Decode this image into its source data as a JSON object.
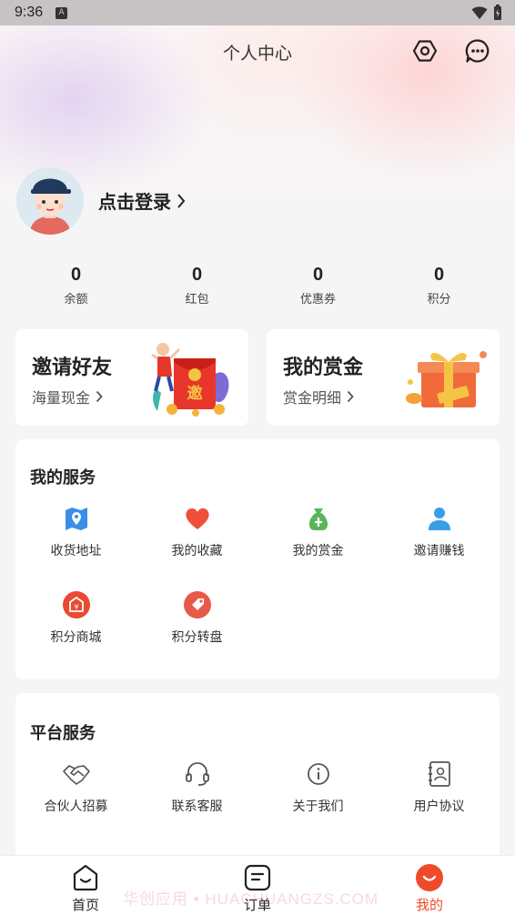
{
  "status_bar": {
    "time": "9:36",
    "notification_icon": "A"
  },
  "header": {
    "title": "个人中心",
    "settings_icon": "settings-hexagon-icon",
    "message_icon": "chat-bubble-icon"
  },
  "profile": {
    "login_label": "点击登录",
    "chevron": "›"
  },
  "stats": [
    {
      "value": "0",
      "label": "余额"
    },
    {
      "value": "0",
      "label": "红包"
    },
    {
      "value": "0",
      "label": "优惠券"
    },
    {
      "value": "0",
      "label": "积分"
    }
  ],
  "promos": {
    "invite": {
      "title": "邀请好友",
      "subtitle": "海量现金",
      "badge_char": "邀"
    },
    "bounty": {
      "title": "我的赏金",
      "subtitle": "赏金明细"
    }
  },
  "my_services": {
    "title": "我的服务",
    "items": [
      {
        "label": "收货地址",
        "icon": "map-pin-icon"
      },
      {
        "label": "我的收藏",
        "icon": "heart-icon"
      },
      {
        "label": "我的赏金",
        "icon": "money-bag-icon"
      },
      {
        "label": "邀请赚钱",
        "icon": "user-icon"
      },
      {
        "label": "积分商城",
        "icon": "shop-icon"
      },
      {
        "label": "积分转盘",
        "icon": "tag-icon"
      }
    ]
  },
  "platform_services": {
    "title": "平台服务",
    "items": [
      {
        "label": "合伙人招募",
        "icon": "handshake-icon"
      },
      {
        "label": "联系客服",
        "icon": "headset-icon"
      },
      {
        "label": "关于我们",
        "icon": "info-icon"
      },
      {
        "label": "用户协议",
        "icon": "contact-book-icon"
      }
    ]
  },
  "bottom_nav": {
    "items": [
      {
        "label": "首页",
        "active": false
      },
      {
        "label": "订单",
        "active": false
      },
      {
        "label": "我的",
        "active": true
      }
    ],
    "active_color": "#f04a2a"
  },
  "watermark": "华创应用 • HUACHUANGZS.COM",
  "colors": {
    "accent": "#f04a2a",
    "blue": "#3a8ee6",
    "green": "#5ab55a"
  }
}
